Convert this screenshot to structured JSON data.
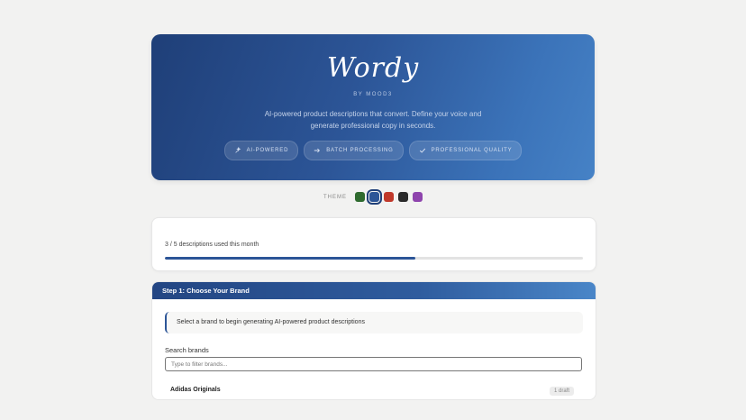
{
  "hero": {
    "logo": "Wordy",
    "byline": "BY MOOD3",
    "tagline": "AI-powered product descriptions that convert. Define your voice and generate professional copy in seconds.",
    "pills": [
      {
        "icon": "sparkle-icon",
        "label": "AI-POWERED"
      },
      {
        "icon": "arrow-right-icon",
        "label": "BATCH PROCESSING"
      },
      {
        "icon": "check-icon",
        "label": "PROFESSIONAL QUALITY"
      }
    ]
  },
  "theme": {
    "label": "THEME",
    "swatches": [
      {
        "name": "green",
        "color": "#2f6b2f"
      },
      {
        "name": "blue",
        "color": "#2c5597",
        "selected": true
      },
      {
        "name": "red",
        "color": "#c0392b"
      },
      {
        "name": "black",
        "color": "#2a2a2a"
      },
      {
        "name": "purple",
        "color": "#8e44ad"
      }
    ]
  },
  "usage": {
    "text": "3 / 5 descriptions used this month",
    "used": 3,
    "limit": 5,
    "progress": 0.6
  },
  "step1": {
    "title": "Step 1: Choose Your Brand",
    "notice": "Select a brand to begin generating AI-powered product descriptions",
    "search_label": "Search brands",
    "search_placeholder": "Type to filter brands...",
    "search_value": "",
    "brands": [
      {
        "name": "Adidas Originals",
        "badge": "1 draft"
      }
    ]
  },
  "colors": {
    "accent": "#2c5597",
    "hero_dark": "#1f3f78",
    "hero_light": "#4682c6",
    "background": "#f2f2f1"
  }
}
